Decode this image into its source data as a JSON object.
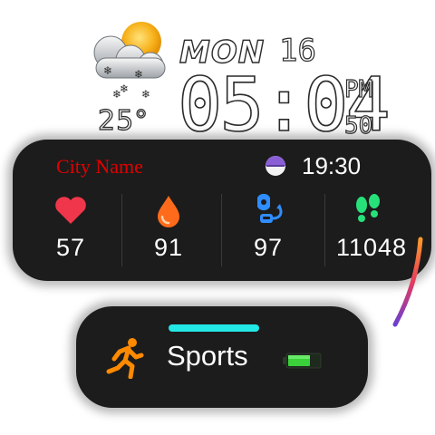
{
  "weather": {
    "icon": "snowy-cloud-sun-icon",
    "temperature": "25°"
  },
  "date": {
    "day_of_week": "MON",
    "day_of_month": "16"
  },
  "time": {
    "main": "05:04",
    "ampm": "PM",
    "seconds": "50"
  },
  "location": {
    "city": "City Name",
    "sunset_icon": "moon-icon",
    "sunset_time": "19:30"
  },
  "stats": [
    {
      "name": "heart-rate",
      "icon": "heart-icon",
      "value": "57",
      "color": "#f0364b"
    },
    {
      "name": "humidity",
      "icon": "drop-icon",
      "value": "91",
      "color": "#ff6b1a"
    },
    {
      "name": "blood-oxygen",
      "icon": "oximeter-icon",
      "value": "97",
      "color": "#2f8dff"
    },
    {
      "name": "steps",
      "icon": "footsteps-icon",
      "value": "11048",
      "color": "#27e07a"
    }
  ],
  "sports": {
    "label": "Sports",
    "icon": "runner-icon",
    "accent_color": "#22e8e6",
    "battery_icon": "battery-icon",
    "battery_color": "#3bd13b"
  }
}
